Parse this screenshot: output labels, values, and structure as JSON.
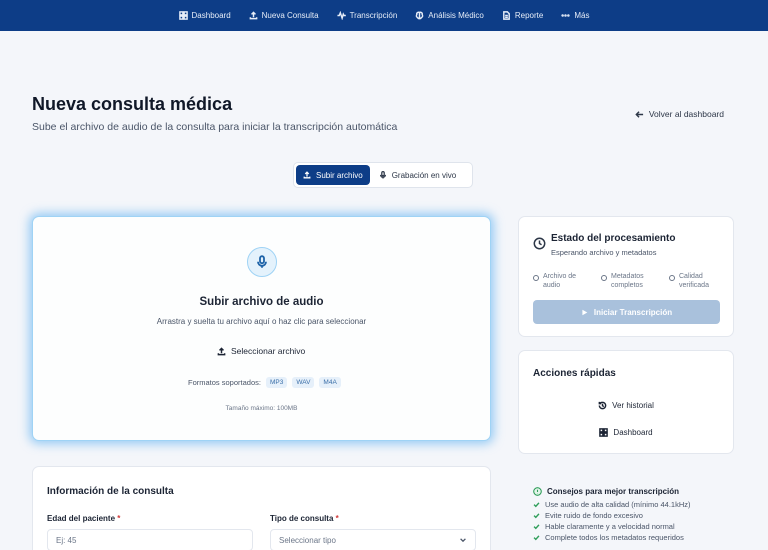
{
  "nav": {
    "items": [
      {
        "label": "Dashboard",
        "icon": "grid-icon"
      },
      {
        "label": "Nueva Consulta",
        "icon": "upload-icon"
      },
      {
        "label": "Transcripción",
        "icon": "waveform-icon"
      },
      {
        "label": "Análisis Médico",
        "icon": "brain-icon"
      },
      {
        "label": "Reporte",
        "icon": "document-icon"
      },
      {
        "label": "Más",
        "icon": "more-icon"
      }
    ]
  },
  "header": {
    "title": "Nueva consulta médica",
    "subtitle": "Sube el archivo de audio de la consulta para iniciar la transcripción automática",
    "back_label": "Volver al dashboard"
  },
  "mode": {
    "upload_label": "Subir archivo",
    "live_label": "Grabación en vivo",
    "active": "upload"
  },
  "upload": {
    "title": "Subir archivo de audio",
    "hint": "Arrastra y suelta tu archivo aquí o haz clic para seleccionar",
    "select_label": "Seleccionar archivo",
    "formats_label": "Formatos soportados:",
    "formats": [
      "MP3",
      "WAV",
      "M4A"
    ],
    "max_size": "Tamaño máximo: 100MB"
  },
  "info": {
    "title": "Información de la consulta",
    "age_label": "Edad del paciente",
    "age_placeholder": "Ej: 45",
    "type_label": "Tipo de consulta",
    "type_placeholder": "Seleccionar tipo"
  },
  "status": {
    "title": "Estado del procesamiento",
    "subtitle": "Esperando archivo y metadatos",
    "steps": [
      "Archivo de audio",
      "Metadatos completos",
      "Calidad verificada"
    ],
    "start_label": "Iniciar Transcripción"
  },
  "quick": {
    "title": "Acciones rápidas",
    "history_label": "Ver historial",
    "dashboard_label": "Dashboard"
  },
  "tips": {
    "title": "Consejos para mejor transcripción",
    "items": [
      "Use audio de alta calidad (mínimo 44.1kHz)",
      "Evite ruido de fondo excesivo",
      "Hable claramente y a velocidad normal",
      "Complete todos los metadatos requeridos"
    ]
  },
  "colors": {
    "primary": "#0d3d87",
    "accent_glow": "#4aa8f0",
    "button_disabled": "#a9c1dc",
    "success": "#2f9e5a",
    "required": "#d23a3a"
  }
}
